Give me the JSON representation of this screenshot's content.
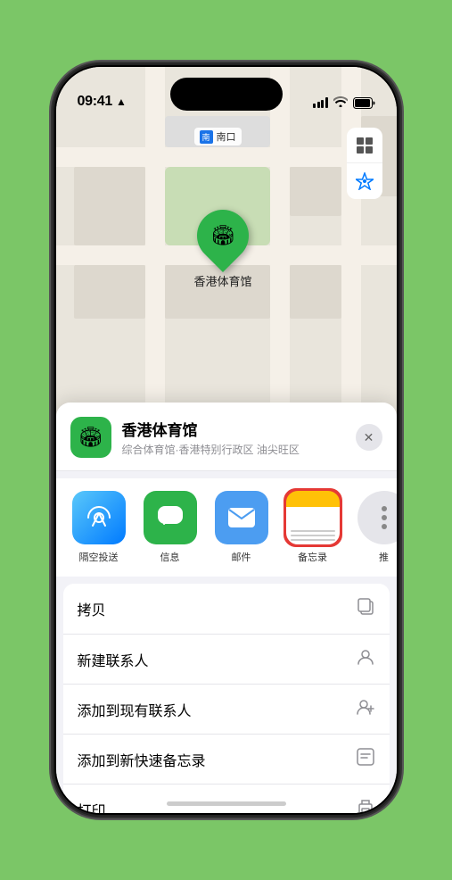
{
  "status": {
    "time": "09:41",
    "time_icon": "navigation-arrow"
  },
  "map": {
    "label": "南口",
    "controls": [
      "map-layers-icon",
      "location-arrow-icon"
    ]
  },
  "marker": {
    "name": "香港体育馆",
    "icon": "🏟"
  },
  "location_header": {
    "icon": "🏟",
    "name": "香港体育馆",
    "description": "综合体育馆·香港特别行政区 油尖旺区",
    "close_label": "✕"
  },
  "share_items": [
    {
      "id": "airdrop",
      "label": "隔空投送",
      "icon_type": "airdrop"
    },
    {
      "id": "messages",
      "label": "信息",
      "icon_type": "messages"
    },
    {
      "id": "mail",
      "label": "邮件",
      "icon_type": "mail"
    },
    {
      "id": "notes",
      "label": "备忘录",
      "icon_type": "notes"
    },
    {
      "id": "more",
      "label": "推",
      "icon_type": "more"
    }
  ],
  "actions": [
    {
      "id": "copy",
      "label": "拷贝",
      "icon": "copy"
    },
    {
      "id": "new-contact",
      "label": "新建联系人",
      "icon": "person"
    },
    {
      "id": "add-contact",
      "label": "添加到现有联系人",
      "icon": "person-add"
    },
    {
      "id": "quick-note",
      "label": "添加到新快速备忘录",
      "icon": "note"
    },
    {
      "id": "print",
      "label": "打印",
      "icon": "printer"
    }
  ]
}
